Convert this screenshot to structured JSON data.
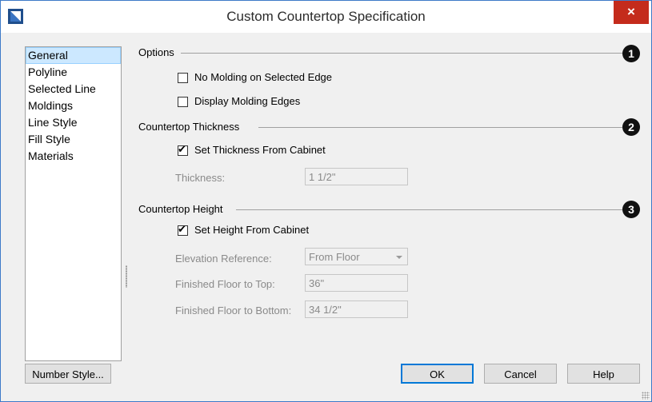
{
  "window": {
    "title": "Custom Countertop Specification",
    "close_glyph": "×"
  },
  "sidebar": {
    "items": [
      {
        "label": "General",
        "selected": true
      },
      {
        "label": "Polyline"
      },
      {
        "label": "Selected Line"
      },
      {
        "label": "Moldings"
      },
      {
        "label": "Line Style"
      },
      {
        "label": "Fill Style"
      },
      {
        "label": "Materials"
      }
    ]
  },
  "sections": {
    "options": {
      "label": "Options",
      "badge": "1",
      "no_molding": {
        "label": "No Molding on Selected Edge",
        "checked": false
      },
      "display_edges": {
        "label": "Display Molding Edges",
        "checked": false
      }
    },
    "thickness": {
      "label": "Countertop Thickness",
      "badge": "2",
      "from_cabinet": {
        "label": "Set Thickness From Cabinet",
        "checked": true
      },
      "thickness_label": "Thickness:",
      "thickness_value": "1 1/2\""
    },
    "height": {
      "label": "Countertop Height",
      "badge": "3",
      "from_cabinet": {
        "label": "Set Height From Cabinet",
        "checked": true
      },
      "elevation_label": "Elevation Reference:",
      "elevation_value": "From Floor",
      "ff_top_label": "Finished Floor to Top:",
      "ff_top_value": "36\"",
      "ff_bottom_label": "Finished Floor to Bottom:",
      "ff_bottom_value": "34 1/2\""
    }
  },
  "buttons": {
    "number_style": "Number Style...",
    "ok": "OK",
    "cancel": "Cancel",
    "help": "Help"
  },
  "colors": {
    "accent": "#0078d7",
    "close": "#c42b1c",
    "selection": "#cce8ff"
  },
  "checkmark": "✔"
}
